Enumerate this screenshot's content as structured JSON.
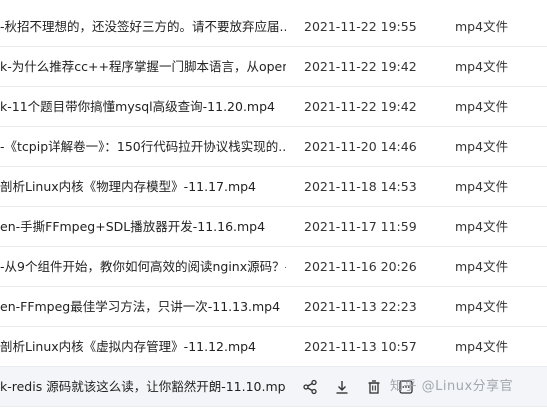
{
  "files": [
    {
      "name": "-秋招不理想的，还没签好三方的。请不要放弃应届...",
      "date": "2021-11-22 19:55",
      "type": "mp4文件"
    },
    {
      "name": "k-为什么推荐cc++程序掌握一门脚本语言，从openr...",
      "date": "2021-11-22 19:42",
      "type": "mp4文件"
    },
    {
      "name": "k-11个题目带你搞懂mysql高级查询-11.20.mp4",
      "date": "2021-11-22 19:42",
      "type": "mp4文件"
    },
    {
      "name": "-《tcpip详解卷一》：150行代码拉开协议栈实现的...",
      "date": "2021-11-20 14:46",
      "type": "mp4文件"
    },
    {
      "name": "剖析Linux内核《物理内存模型》-11.17.mp4",
      "date": "2021-11-18 14:53",
      "type": "mp4文件"
    },
    {
      "name": "en-手撕FFmpeg+SDL播放器开发-11.16.mp4",
      "date": "2021-11-17 11:59",
      "type": "mp4文件"
    },
    {
      "name": "-从9个组件开始，教你如何高效的阅读nginx源码？-...",
      "date": "2021-11-16 20:26",
      "type": "mp4文件"
    },
    {
      "name": "en-FFmpeg最佳学习方法，只讲一次-11.13.mp4",
      "date": "2021-11-13 22:23",
      "type": "mp4文件"
    },
    {
      "name": "剖析Linux内核《虚拟内存管理》-11.12.mp4",
      "date": "2021-11-13 10:57",
      "type": "mp4文件"
    }
  ],
  "hover_row": {
    "name": "k-redis 源码就该这么读，让你豁然开朗-11.10.mp4",
    "actions": [
      {
        "icon": "share-icon"
      },
      {
        "icon": "download-icon"
      },
      {
        "icon": "delete-icon"
      },
      {
        "icon": "more-icon"
      }
    ],
    "watermark": "知乎 @Linux分享官"
  }
}
